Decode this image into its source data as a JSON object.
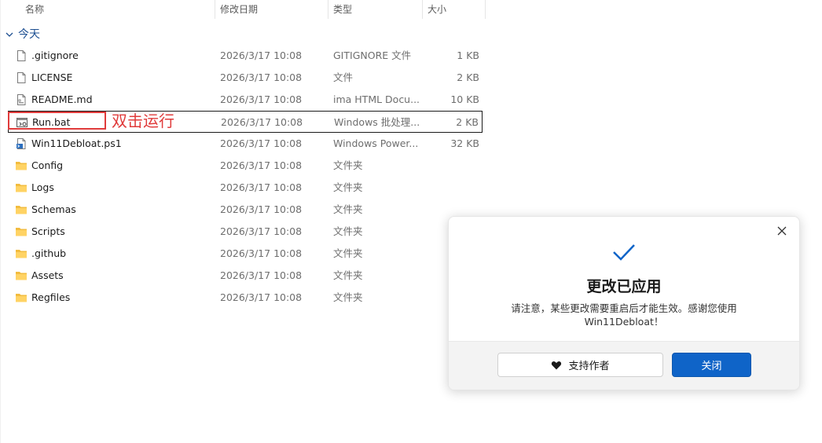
{
  "columns": {
    "name": "名称",
    "date": "修改日期",
    "type": "类型",
    "size": "大小"
  },
  "group": {
    "label": "今天",
    "expanded_icon": "chevron-down-icon"
  },
  "files": [
    {
      "name": ".gitignore",
      "date": "2026/3/17 10:08",
      "type": "GITIGNORE 文件",
      "size": "1 KB",
      "icon": "file-icon"
    },
    {
      "name": "LICENSE",
      "date": "2026/3/17 10:08",
      "type": "文件",
      "size": "2 KB",
      "icon": "file-icon"
    },
    {
      "name": "README.md",
      "date": "2026/3/17 10:08",
      "type": "ima HTML Docu...",
      "size": "10 KB",
      "icon": "markdown-file-icon"
    },
    {
      "name": "Run.bat",
      "date": "2026/3/17 10:08",
      "type": "Windows 批处理...",
      "size": "2 KB",
      "icon": "batch-file-icon"
    },
    {
      "name": "Win11Debloat.ps1",
      "date": "2026/3/17 10:08",
      "type": "Windows Power...",
      "size": "32 KB",
      "icon": "powershell-file-icon"
    },
    {
      "name": "Config",
      "date": "2026/3/17 10:08",
      "type": "文件夹",
      "size": "",
      "icon": "folder-icon"
    },
    {
      "name": "Logs",
      "date": "2026/3/17 10:08",
      "type": "文件夹",
      "size": "",
      "icon": "folder-icon"
    },
    {
      "name": "Schemas",
      "date": "2026/3/17 10:08",
      "type": "文件夹",
      "size": "",
      "icon": "folder-icon"
    },
    {
      "name": "Scripts",
      "date": "2026/3/17 10:08",
      "type": "文件夹",
      "size": "",
      "icon": "folder-icon"
    },
    {
      "name": ".github",
      "date": "2026/3/17 10:08",
      "type": "文件夹",
      "size": "",
      "icon": "folder-icon"
    },
    {
      "name": "Assets",
      "date": "2026/3/17 10:08",
      "type": "文件夹",
      "size": "",
      "icon": "folder-icon"
    },
    {
      "name": "Regfiles",
      "date": "2026/3/17 10:08",
      "type": "文件夹",
      "size": "",
      "icon": "folder-icon"
    }
  ],
  "annotation": {
    "text": "双击运行",
    "color": "#e03b3b"
  },
  "dialog": {
    "title": "更改已应用",
    "message": "请注意，某些更改需要重启后才能生效。感谢您使用 Win11Debloat！",
    "support_label": "支持作者",
    "close_label": "关闭",
    "accent": "#0f64c8"
  }
}
